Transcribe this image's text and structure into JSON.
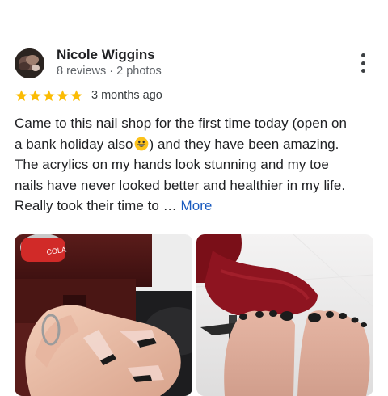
{
  "review": {
    "author_name": "Nicole Wiggins",
    "author_meta": "8 reviews · 2 photos",
    "rating": 5,
    "rating_max": 5,
    "date": "3 months ago",
    "text_lines": [
      "Came to this nail shop for the first time today (open on",
      "a bank holiday also",
      ") and they have been amazing.",
      "The acrylics on my hands look stunning and my toe",
      "nails have never looked better and healthier in my life.",
      "Really took their time to … "
    ],
    "more_label": "More",
    "star_color": "#fbbc04",
    "link_color": "#1a5bbf",
    "photos": [
      "hand-nails-photo",
      "toe-nails-photo"
    ]
  }
}
